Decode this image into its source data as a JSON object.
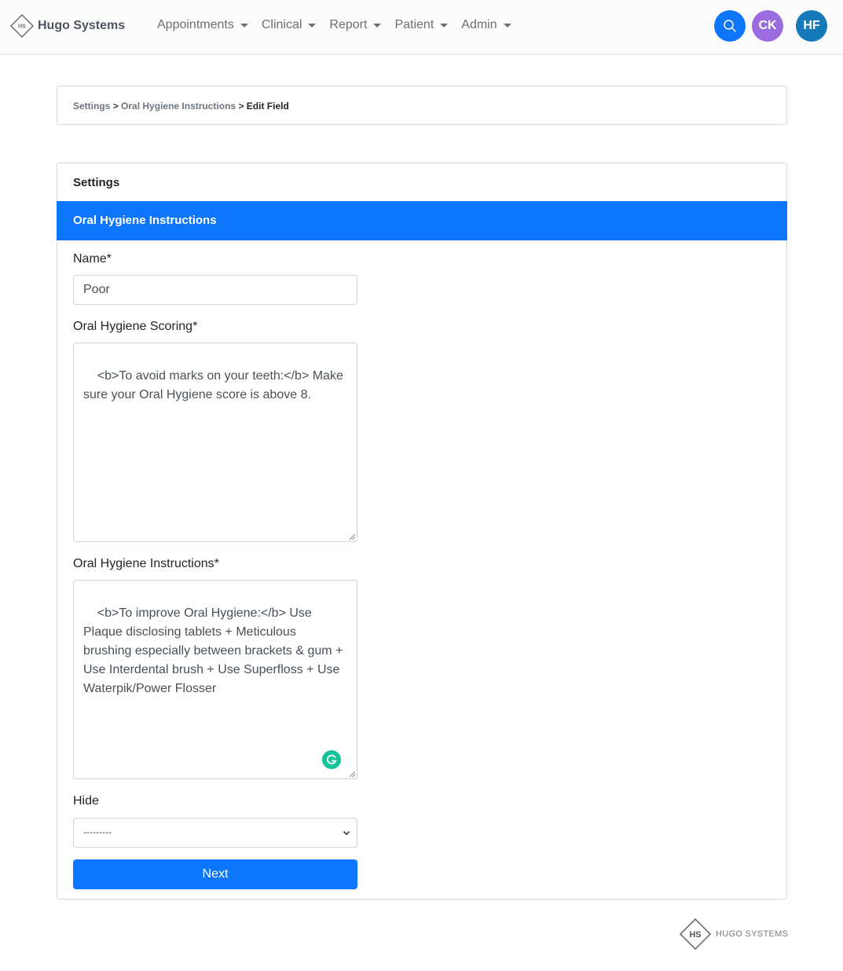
{
  "navbar": {
    "brand": {
      "logo_text": "HS",
      "name": "Hugo Systems"
    },
    "menu": [
      {
        "label": "Appointments",
        "icon": "caret-down-icon"
      },
      {
        "label": "Clinical",
        "icon": "caret-down-icon"
      },
      {
        "label": "Report",
        "icon": "caret-down-icon"
      },
      {
        "label": "Patient",
        "icon": "caret-down-icon"
      },
      {
        "label": "Admin",
        "icon": "caret-down-icon"
      }
    ],
    "search": {
      "icon": "search-icon",
      "color": "#0d76fd"
    },
    "avatars": [
      {
        "initials": "CK",
        "color": "#9b6ce0"
      },
      {
        "initials": "HF",
        "color": "#167ab9"
      }
    ]
  },
  "breadcrumb": {
    "items": [
      "Settings",
      "Oral Hygiene Instructions"
    ],
    "separator": ">",
    "current": "Edit Field"
  },
  "card": {
    "title": "Settings",
    "section": "Oral Hygiene Instructions",
    "accent_color": "#0d76fd"
  },
  "form": {
    "name": {
      "label": "Name*",
      "value": "Poor"
    },
    "scoring": {
      "label": "Oral Hygiene Scoring*",
      "value": "<b>To avoid marks on your teeth:</b> Make sure your Oral Hygiene score is above 8."
    },
    "instructions": {
      "label": "Oral Hygiene Instructions*",
      "value": "<b>To improve Oral Hygiene:</b> Use Plaque disclosing tablets + Meticulous brushing especially between brackets & gum + Use Interdental brush + Use Superfloss + Use Waterpik/Power Flosser",
      "grammarly_icon": "grammarly-icon"
    },
    "hide": {
      "label": "Hide",
      "selected": "---------"
    },
    "submit_label": "Next"
  },
  "footer": {
    "logo_text": "HS",
    "brand": "HUGO SYSTEMS"
  }
}
